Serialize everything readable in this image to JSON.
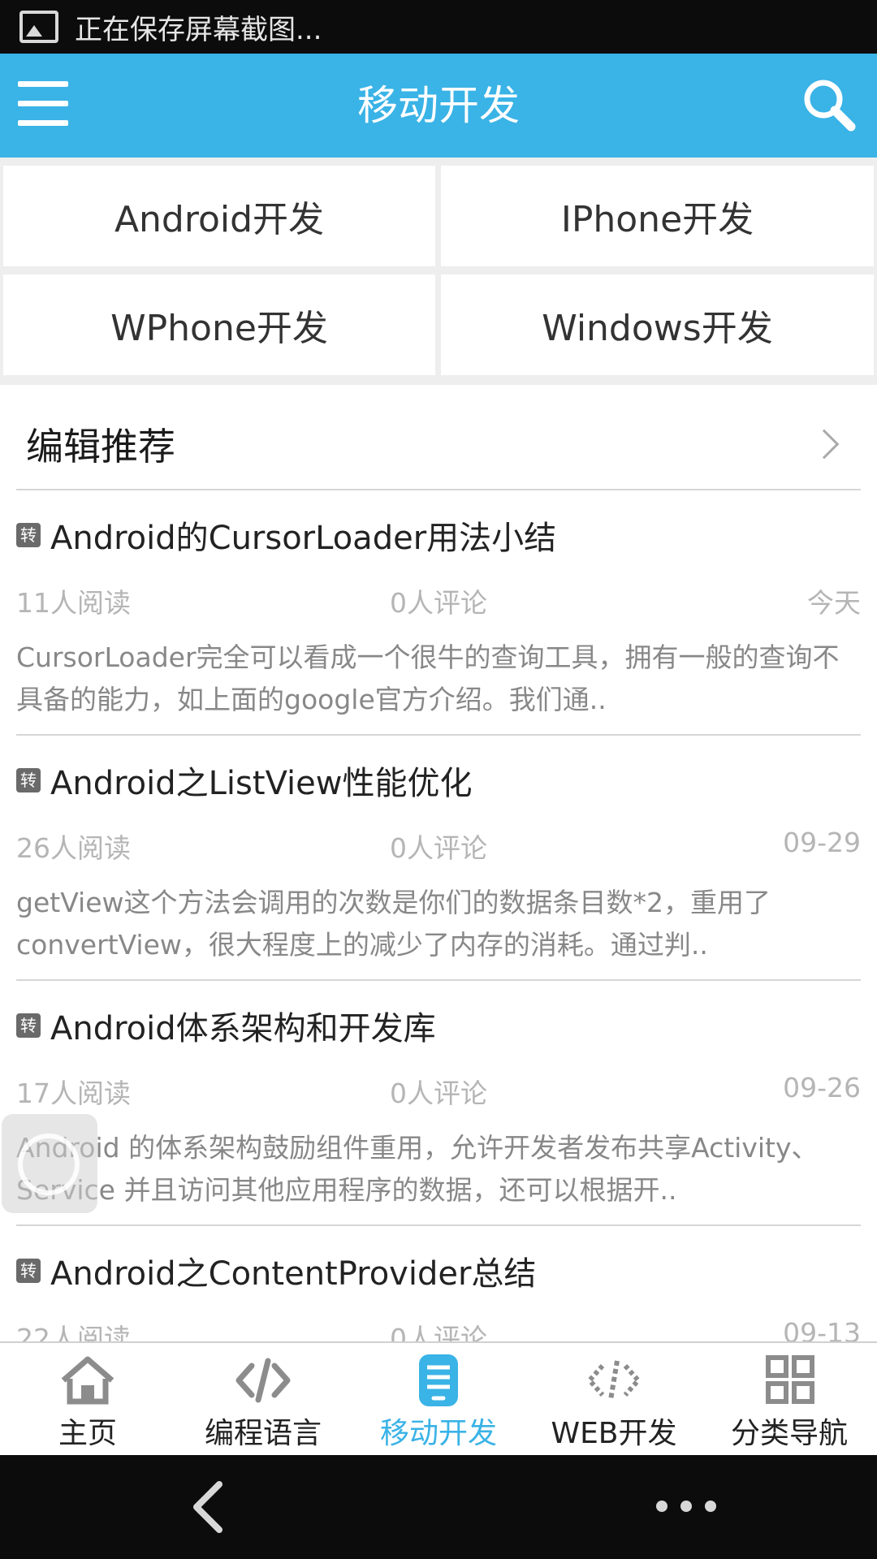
{
  "status_bar": {
    "text": "正在保存屏幕截图..."
  },
  "title_bar": {
    "title": "移动开发"
  },
  "categories": [
    "Android开发",
    "IPhone开发",
    "WPhone开发",
    "Windows开发"
  ],
  "section": {
    "title": "编辑推荐"
  },
  "articles": [
    {
      "badge": "转",
      "title": "Android的CursorLoader用法小结",
      "reads": "11人阅读",
      "comments": "0人评论",
      "date": "今天",
      "summary": "CursorLoader完全可以看成一个很牛的查询工具，拥有一般的查询不具备的能力，如上面的google官方介绍。我们通.."
    },
    {
      "badge": "转",
      "title": "Android之ListView性能优化",
      "reads": "26人阅读",
      "comments": "0人评论",
      "date": "09-29",
      "summary": "getView这个方法会调用的次数是你们的数据条目数*2，重用了convertView，很大程度上的减少了内存的消耗。通过判.."
    },
    {
      "badge": "转",
      "title": "Android体系架构和开发库",
      "reads": "17人阅读",
      "comments": "0人评论",
      "date": "09-26",
      "summary": "Android 的体系架构鼓励组件重用，允许开发者发布共享Activity、Service 并且访问其他应用程序的数据，还可以根据开.."
    },
    {
      "badge": "转",
      "title": "Android之ContentProvider总结",
      "reads": "22人阅读",
      "comments": "0人评论",
      "date": "09-13",
      "summary": ""
    }
  ],
  "tabs": [
    {
      "label": "主页",
      "icon": "home-icon",
      "active": false
    },
    {
      "label": "编程语言",
      "icon": "code-icon",
      "active": false
    },
    {
      "label": "移动开发",
      "icon": "mobile-icon",
      "active": true
    },
    {
      "label": "WEB开发",
      "icon": "web-code-icon",
      "active": false
    },
    {
      "label": "分类导航",
      "icon": "grid-icon",
      "active": false
    }
  ],
  "colors": {
    "accent": "#3ab3e6",
    "tab_inactive": "#8c8c8c"
  }
}
